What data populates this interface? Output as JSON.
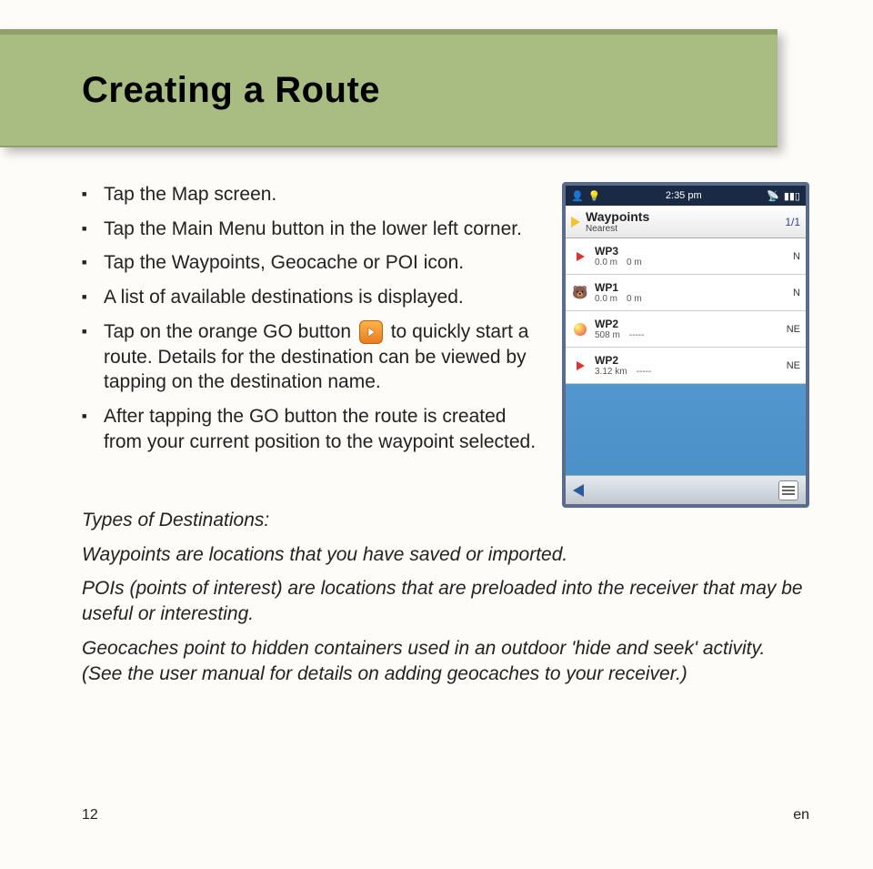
{
  "header": {
    "title": "Creating a Route"
  },
  "bullets": [
    "Tap the Map screen.",
    "Tap the Main Menu button in the lower left corner.",
    "Tap the Waypoints, Geocache or POI icon.",
    "A list of available destinations is displayed."
  ],
  "go_bullet": {
    "part1": "Tap on the orange GO button ",
    "part2": " to quickly start a route. Details for the destination can be viewed by tapping on the destination name."
  },
  "bullets2": [
    "After tapping the GO button the route is created from your current position to the waypoint selected."
  ],
  "paras": [
    {
      "text": "Types of Destinations:",
      "italic": true
    },
    {
      "text": "Waypoints are locations that you have saved or imported.",
      "italic": true
    },
    {
      "text": "POIs (points of interest) are locations that are preloaded into the receiver that may be useful or interesting.",
      "italic": true
    },
    {
      "text": "Geocaches point to hidden containers used in an outdoor 'hide and seek' activity. (See the user manual for details on adding geocaches to your receiver.)",
      "italic": true
    }
  ],
  "footer": {
    "page": "12",
    "lang": "en"
  },
  "device": {
    "status": {
      "time": "2:35 pm"
    },
    "header": {
      "title": "Waypoints",
      "sub": "Nearest",
      "page": "1/1"
    },
    "rows": [
      {
        "icon": "flag",
        "name": "WP3",
        "d1": "0.0 m",
        "d2": "0 m",
        "dir": "N"
      },
      {
        "icon": "bear",
        "name": "WP1",
        "d1": "0.0 m",
        "d2": "0 m",
        "dir": "N"
      },
      {
        "icon": "balloon",
        "name": "WP2",
        "d1": "508 m",
        "d2": "-----",
        "dir": "NE"
      },
      {
        "icon": "flag",
        "name": "WP2",
        "d1": "3.12 km",
        "d2": "-----",
        "dir": "NE"
      }
    ]
  }
}
